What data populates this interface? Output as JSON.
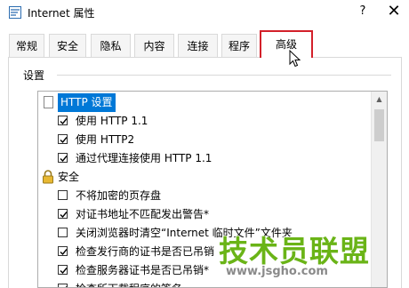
{
  "window": {
    "title": "Internet 属性",
    "help_label": "?",
    "close_label": "✕"
  },
  "tabs": [
    {
      "label": "常规",
      "active": false
    },
    {
      "label": "安全",
      "active": false
    },
    {
      "label": "隐私",
      "active": false
    },
    {
      "label": "内容",
      "active": false
    },
    {
      "label": "连接",
      "active": false
    },
    {
      "label": "程序",
      "active": false
    },
    {
      "label": "高级",
      "active": true
    }
  ],
  "settings": {
    "group_label": "设置",
    "items": [
      {
        "label": "HTTP 设置",
        "type": "category",
        "icon": "page-icon",
        "selected": true
      },
      {
        "label": "使用 HTTP 1.1",
        "type": "checkbox",
        "checked": true
      },
      {
        "label": "使用 HTTP2",
        "type": "checkbox",
        "checked": true
      },
      {
        "label": "通过代理连接使用 HTTP 1.1",
        "type": "checkbox",
        "checked": true
      },
      {
        "label": "安全",
        "type": "category",
        "icon": "lock-icon",
        "selected": false
      },
      {
        "label": "不将加密的页存盘",
        "type": "checkbox",
        "checked": false
      },
      {
        "label": "对证书地址不匹配发出警告*",
        "type": "checkbox",
        "checked": true
      },
      {
        "label": "关闭浏览器时清空“Internet 临时文件”文件夹",
        "type": "checkbox",
        "checked": false
      },
      {
        "label": "检查发行商的证书是否已吊销",
        "type": "checkbox",
        "checked": true
      },
      {
        "label": "检查服务器证书是否已吊销*",
        "type": "checkbox",
        "checked": true
      },
      {
        "label": "检查所下载程序的签名",
        "type": "checkbox",
        "checked": true
      }
    ]
  },
  "watermark": {
    "main": "技术员联盟",
    "url": "www.jsgho.com"
  },
  "colors": {
    "selection": "#0078d7",
    "highlight_border": "#d3202a",
    "watermark_green": "#6ab417"
  }
}
